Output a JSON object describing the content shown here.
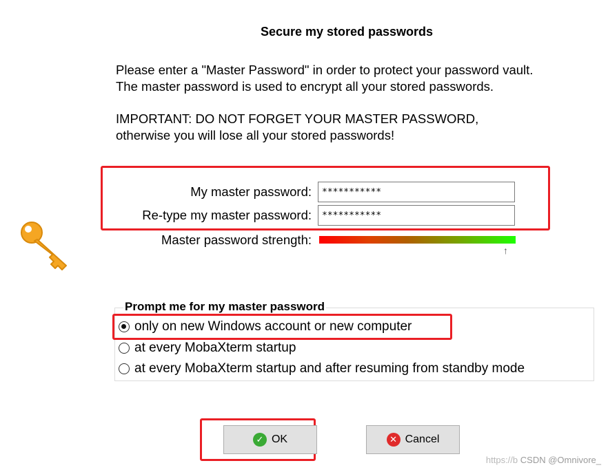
{
  "dialog": {
    "title": "Secure my stored passwords",
    "intro_line1": "Please enter a \"Master Password\" in order to protect your password vault.",
    "intro_line2": "The master password is used to encrypt all your stored passwords.",
    "warning_line1": "IMPORTANT:  DO NOT FORGET YOUR MASTER PASSWORD,",
    "warning_line2": "otherwise you will lose all your stored passwords!"
  },
  "form": {
    "master_label": "My master password:",
    "master_value": "***********",
    "retype_label": "Re-type my master password:",
    "retype_value": "***********",
    "strength_label": "Master password strength:",
    "strength_level": 0.97
  },
  "prompt_group": {
    "title": "Prompt me for my master password",
    "options": [
      {
        "label": "only on new Windows account or new computer",
        "checked": true
      },
      {
        "label": "at every MobaXterm startup",
        "checked": false
      },
      {
        "label": "at every MobaXterm startup and after resuming from standby mode",
        "checked": false
      }
    ]
  },
  "buttons": {
    "ok_label": "OK",
    "cancel_label": "Cancel"
  },
  "colors": {
    "highlight_red": "#ea1f25",
    "ok_icon": "#3aaa35",
    "cancel_icon": "#e02b2b",
    "key_gold": "#f5a623"
  },
  "watermark": {
    "faint": "https://b",
    "csdn": "CSDN @Omnivore_"
  }
}
